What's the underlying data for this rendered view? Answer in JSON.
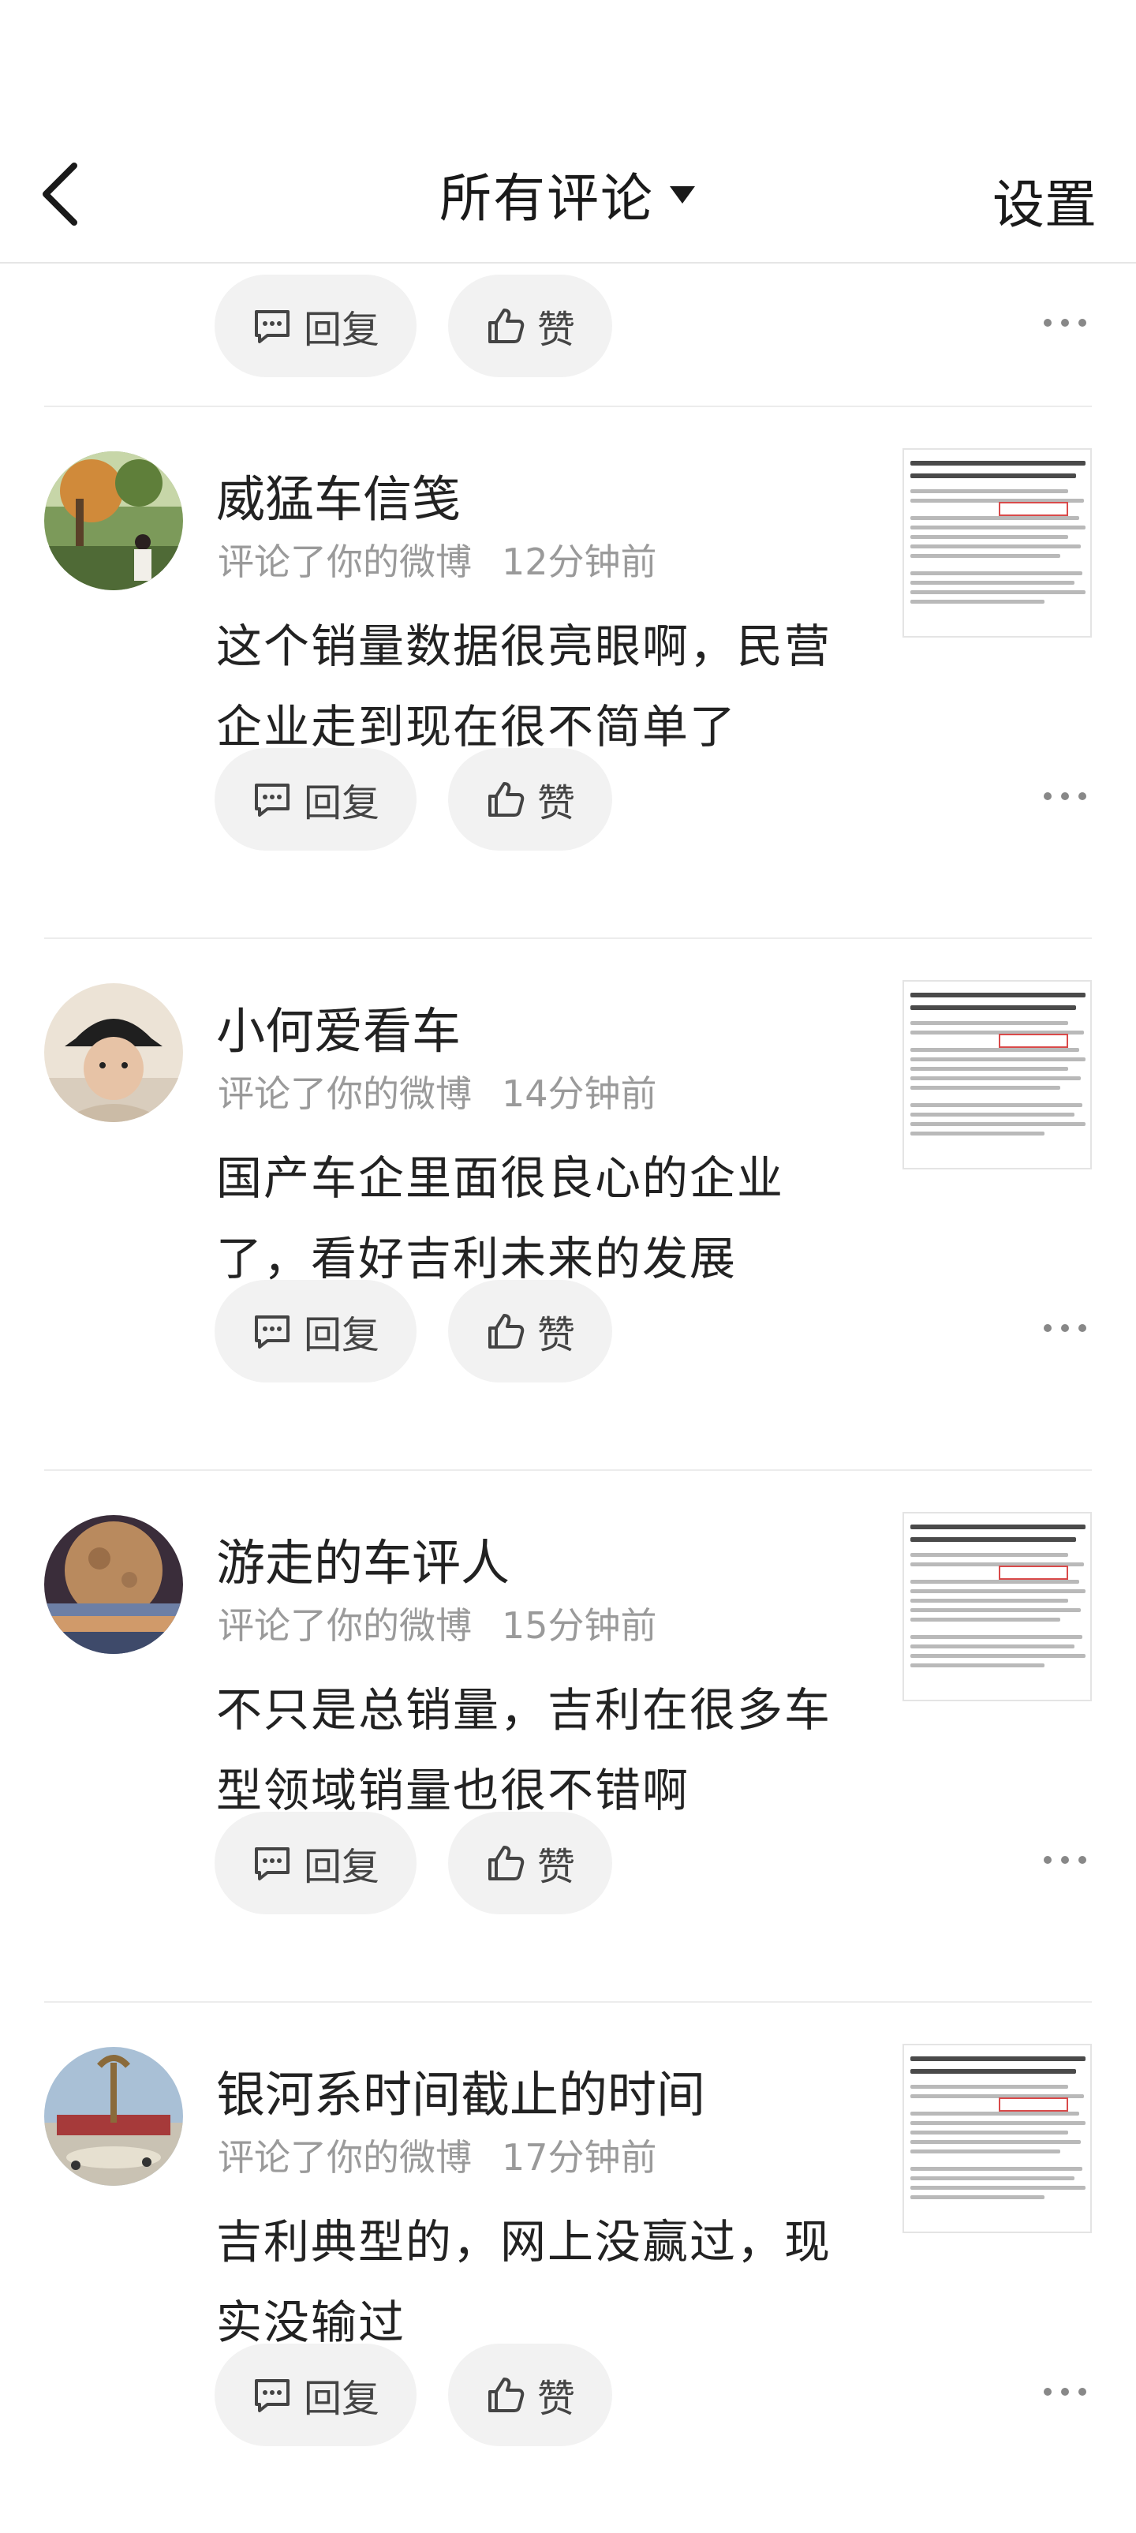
{
  "header": {
    "title": "所有评论",
    "settings_label": "设置"
  },
  "actions": {
    "reply_label": "回复",
    "like_label": "赞"
  },
  "comments": [
    {
      "user": "威猛车信笺",
      "action": "评论了你的微博",
      "time": "12分钟前",
      "text": "这个销量数据很亮眼啊，民营企业走到现在很不简单了",
      "avatar_colors": [
        "#6b8f3a",
        "#c98a3a",
        "#3b4f2a"
      ]
    },
    {
      "user": "小何爱看车",
      "action": "评论了你的微博",
      "time": "14分钟前",
      "text": "国产车企里面很良心的企业了，看好吉利未来的发展",
      "avatar_colors": [
        "#e8dccb",
        "#2a2a2a",
        "#d7b59a"
      ]
    },
    {
      "user": "游走的车评人",
      "action": "评论了你的微博",
      "time": "15分钟前",
      "text": "不只是总销量，吉利在很多车型领域销量也很不错啊",
      "avatar_colors": [
        "#3a2e3f",
        "#b07a4a",
        "#6a8ab0"
      ]
    },
    {
      "user": "银河系时间截止的时间",
      "action": "评论了你的微博",
      "time": "17分钟前",
      "text": "吉利典型的，网上没赢过，现实没输过",
      "avatar_colors": [
        "#9ab3c9",
        "#a04040",
        "#d8c9a0"
      ]
    }
  ]
}
